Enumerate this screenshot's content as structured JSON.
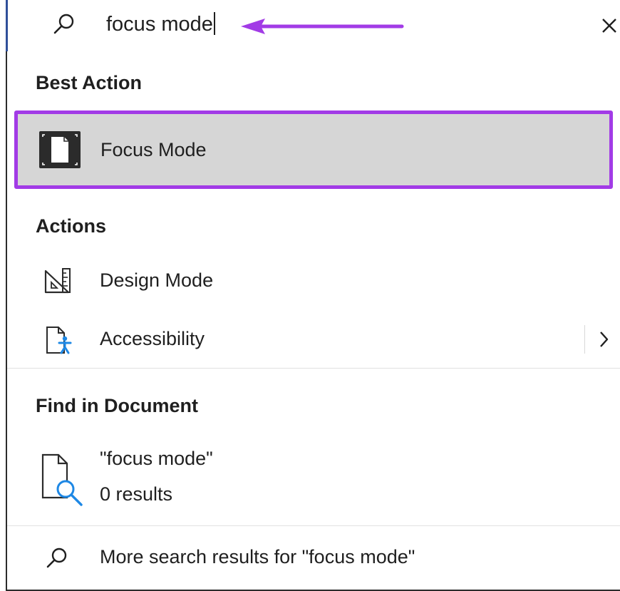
{
  "search": {
    "value": "focus mode",
    "clear_icon": "close-icon",
    "search_icon": "search-icon"
  },
  "best_action": {
    "heading": "Best Action",
    "item": {
      "label": "Focus Mode",
      "icon": "focus-mode-icon"
    }
  },
  "actions": {
    "heading": "Actions",
    "items": [
      {
        "label": "Design Mode",
        "icon": "design-mode-icon"
      },
      {
        "label": "Accessibility",
        "icon": "accessibility-icon",
        "has_submenu": true
      }
    ]
  },
  "find_in_document": {
    "heading": "Find in Document",
    "query": "\"focus mode\"",
    "results": "0 results",
    "icon": "document-search-icon"
  },
  "more_results": {
    "label": "More search results for \"focus mode\"",
    "icon": "search-icon"
  },
  "colors": {
    "highlight_border": "#a23be6",
    "highlight_background": "#d6d6d6",
    "annotation_arrow": "#a23be6",
    "text": "#1f1f1f",
    "left_edge_accent": "#2f4f9a"
  }
}
